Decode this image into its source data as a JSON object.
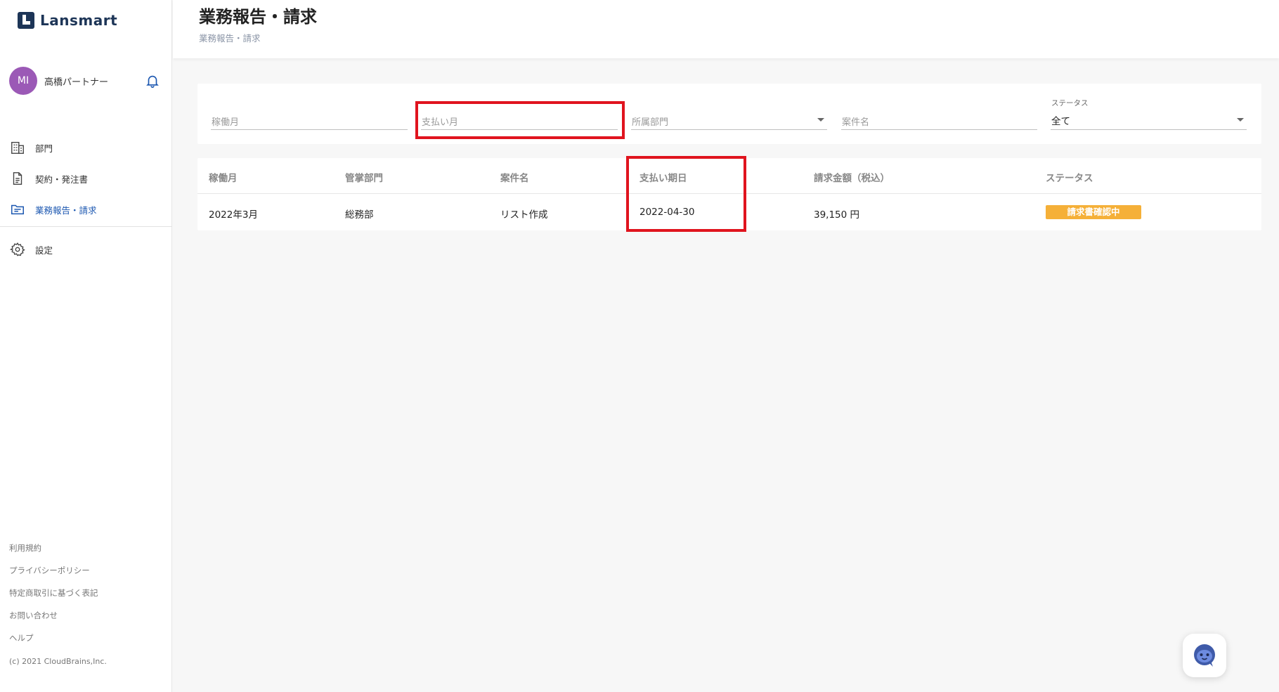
{
  "app": {
    "logo_text": "Lansmart",
    "user_avatar": "MI",
    "user_name": "高橋パートナー"
  },
  "sidebar": {
    "items": [
      {
        "label": "部門",
        "icon": "building-icon"
      },
      {
        "label": "契約・発注書",
        "icon": "document-icon"
      },
      {
        "label": "業務報告・請求",
        "icon": "folder-icon",
        "active": true
      }
    ],
    "settings": {
      "label": "設定",
      "icon": "gear-icon"
    },
    "footer": [
      "利用規約",
      "プライバシーポリシー",
      "特定商取引に基づく表記",
      "お問い合わせ",
      "ヘルプ"
    ],
    "copyright": "(c) 2021 CloudBrains,Inc."
  },
  "header": {
    "title": "業務報告・請求",
    "breadcrumb": "業務報告・請求"
  },
  "filters": {
    "work_month_placeholder": "稼働月",
    "payment_month_placeholder": "支払い月",
    "department_placeholder": "所属部門",
    "project_placeholder": "案件名",
    "status_label": "ステータス",
    "status_value": "全て"
  },
  "table": {
    "headers": [
      "稼働月",
      "管掌部門",
      "案件名",
      "支払い期日",
      "請求金額（税込）",
      "ステータス"
    ],
    "rows": [
      {
        "work_month": "2022年3月",
        "department": "総務部",
        "project": "リスト作成",
        "due_date": "2022-04-30",
        "amount": "39,150 円",
        "status": "請求書確認中"
      }
    ]
  },
  "colors": {
    "primary": "#1d3557",
    "active_nav": "#1a56b0",
    "avatar": "#9b59b6",
    "status_badge": "#f5b038",
    "highlight": "#e0141e"
  }
}
